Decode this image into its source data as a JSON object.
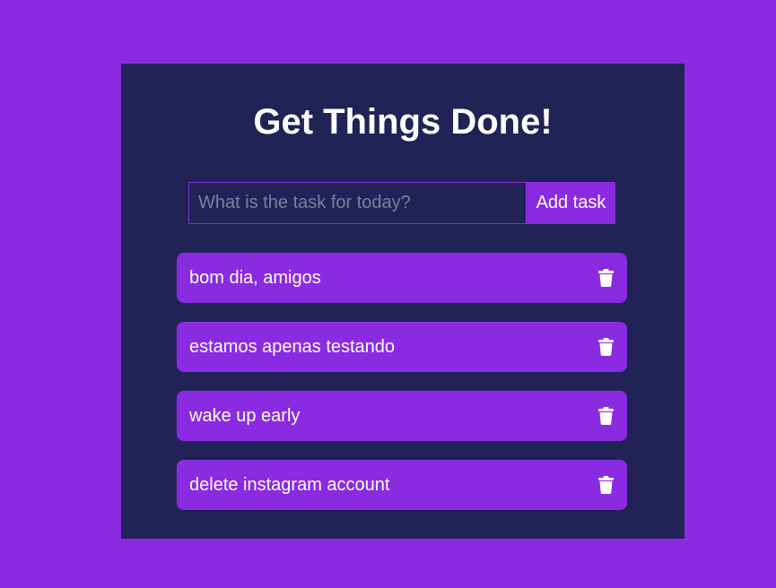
{
  "app": {
    "title": "Get Things Done!"
  },
  "form": {
    "placeholder": "What is the task for today?",
    "value": "",
    "add_label": "Add task"
  },
  "tasks": [
    {
      "text": "bom dia, amigos",
      "icon": "trash-icon"
    },
    {
      "text": "estamos apenas testando",
      "icon": "trash-icon"
    },
    {
      "text": "wake up early",
      "icon": "trash-icon"
    },
    {
      "text": "delete instagram account",
      "icon": "trash-icon"
    }
  ],
  "colors": {
    "page_background": "#8a2be2",
    "card_background": "#212356",
    "accent": "#8a2be2",
    "text": "#ffffff"
  }
}
